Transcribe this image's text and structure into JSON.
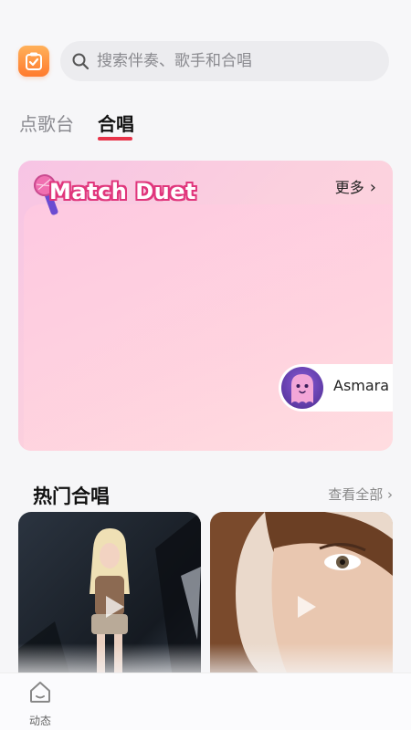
{
  "search": {
    "placeholder": "搜索伴奏、歌手和合唱"
  },
  "tabs": [
    {
      "label": "点歌台"
    },
    {
      "label": "合唱"
    }
  ],
  "banner": {
    "title": "Match Duet",
    "more_label": "更多",
    "user_name": "Asmara"
  },
  "hot": {
    "title": "热门合唱",
    "view_all_label": "查看全部"
  },
  "nav": {
    "items": [
      {
        "label": "动态",
        "icon": "home-icon"
      }
    ]
  },
  "colors": {
    "accent": "#e8344a",
    "brand": "#ff7a2d",
    "banner_pink": "#f7c4e4"
  }
}
